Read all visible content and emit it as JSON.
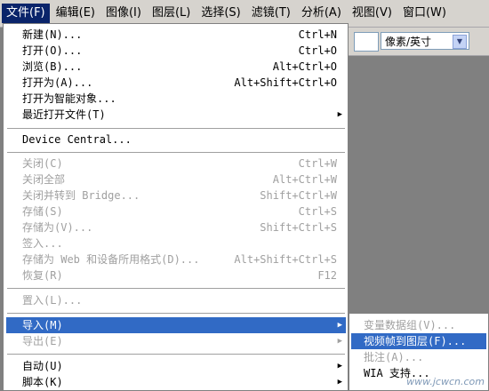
{
  "menubar": {
    "items": [
      "文件(F)",
      "编辑(E)",
      "图像(I)",
      "图层(L)",
      "选择(S)",
      "滤镜(T)",
      "分析(A)",
      "视图(V)",
      "窗口(W)"
    ]
  },
  "options_bar": {
    "unit_select": "像素/英寸"
  },
  "file_menu": {
    "items": [
      {
        "label": "新建(N)...",
        "shortcut": "Ctrl+N"
      },
      {
        "label": "打开(O)...",
        "shortcut": "Ctrl+O"
      },
      {
        "label": "浏览(B)...",
        "shortcut": "Alt+Ctrl+O"
      },
      {
        "label": "打开为(A)...",
        "shortcut": "Alt+Shift+Ctrl+O"
      },
      {
        "label": "打开为智能对象...",
        "shortcut": ""
      },
      {
        "label": "最近打开文件(T)",
        "shortcut": ""
      },
      {
        "label": "Device Central...",
        "shortcut": ""
      },
      {
        "label": "关闭(C)",
        "shortcut": "Ctrl+W"
      },
      {
        "label": "关闭全部",
        "shortcut": "Alt+Ctrl+W"
      },
      {
        "label": "关闭并转到 Bridge...",
        "shortcut": "Shift+Ctrl+W"
      },
      {
        "label": "存储(S)",
        "shortcut": "Ctrl+S"
      },
      {
        "label": "存储为(V)...",
        "shortcut": "Shift+Ctrl+S"
      },
      {
        "label": "签入...",
        "shortcut": ""
      },
      {
        "label": "存储为 Web 和设备所用格式(D)...",
        "shortcut": "Alt+Shift+Ctrl+S"
      },
      {
        "label": "恢复(R)",
        "shortcut": "F12"
      },
      {
        "label": "置入(L)...",
        "shortcut": ""
      },
      {
        "label": "导入(M)",
        "shortcut": ""
      },
      {
        "label": "导出(E)",
        "shortcut": ""
      },
      {
        "label": "自动(U)",
        "shortcut": ""
      },
      {
        "label": "脚本(K)",
        "shortcut": ""
      }
    ]
  },
  "import_submenu": {
    "items": [
      "变量数据组(V)...",
      "视频帧到图层(F)...",
      "批注(A)...",
      "WIA 支持..."
    ]
  },
  "watermark": "www.jcwcn.com"
}
